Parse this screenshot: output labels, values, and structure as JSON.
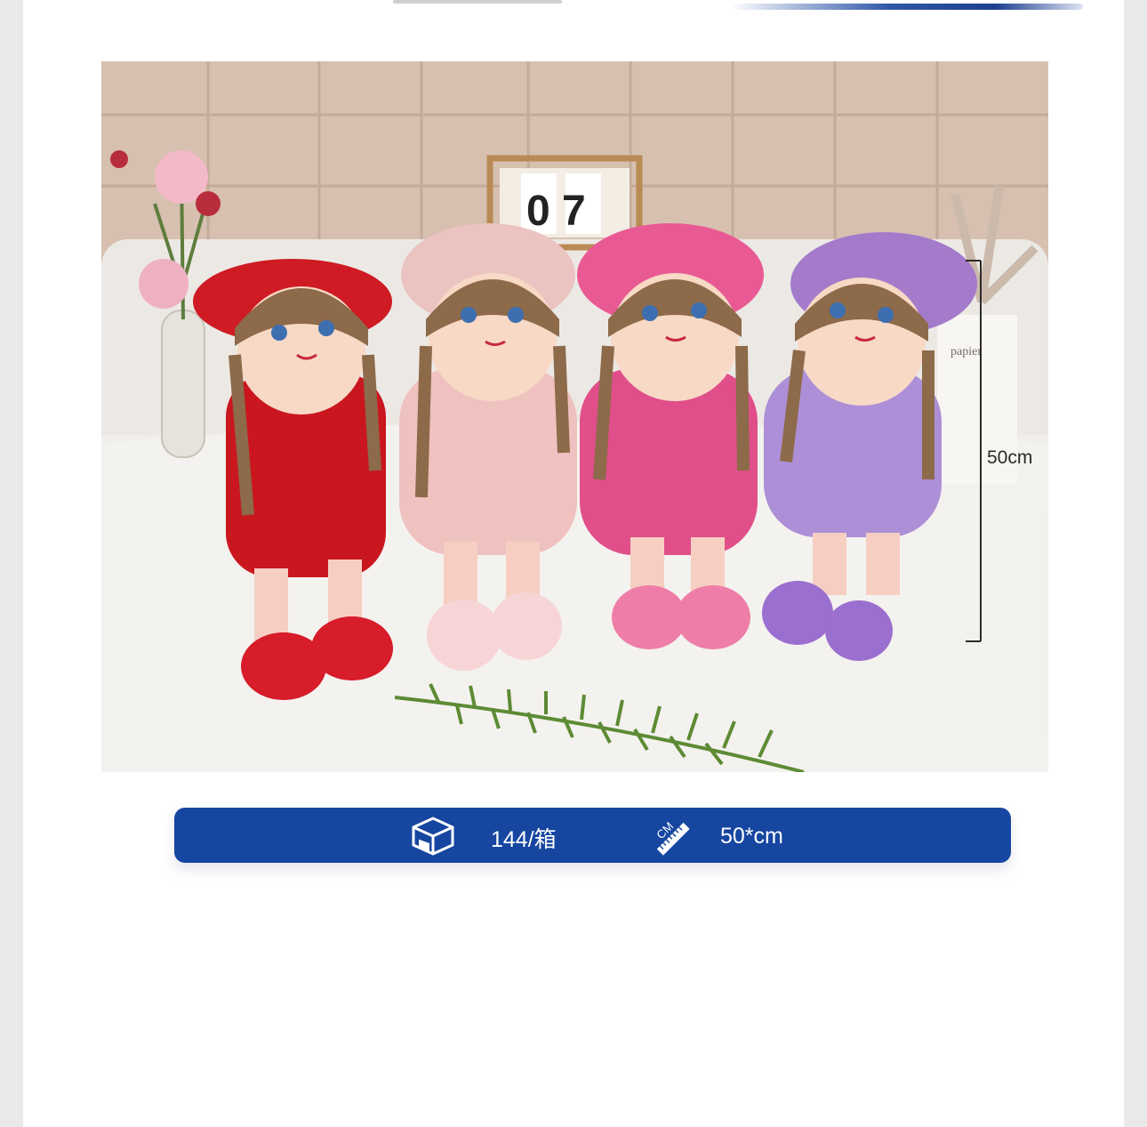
{
  "product_photo": {
    "calendar_digits": "0 7",
    "card_text": "papier",
    "height_annotation": "50cm"
  },
  "info_bar": {
    "quantity_icon": "box-icon",
    "quantity": "144/箱",
    "size_icon": "ruler-cm-icon",
    "ruler_text": "CM",
    "size": "50*cm"
  },
  "colors": {
    "info_bar_bg": "#1646a0",
    "accent_rule": "#2f57a8",
    "page_bg": "#ffffff"
  }
}
